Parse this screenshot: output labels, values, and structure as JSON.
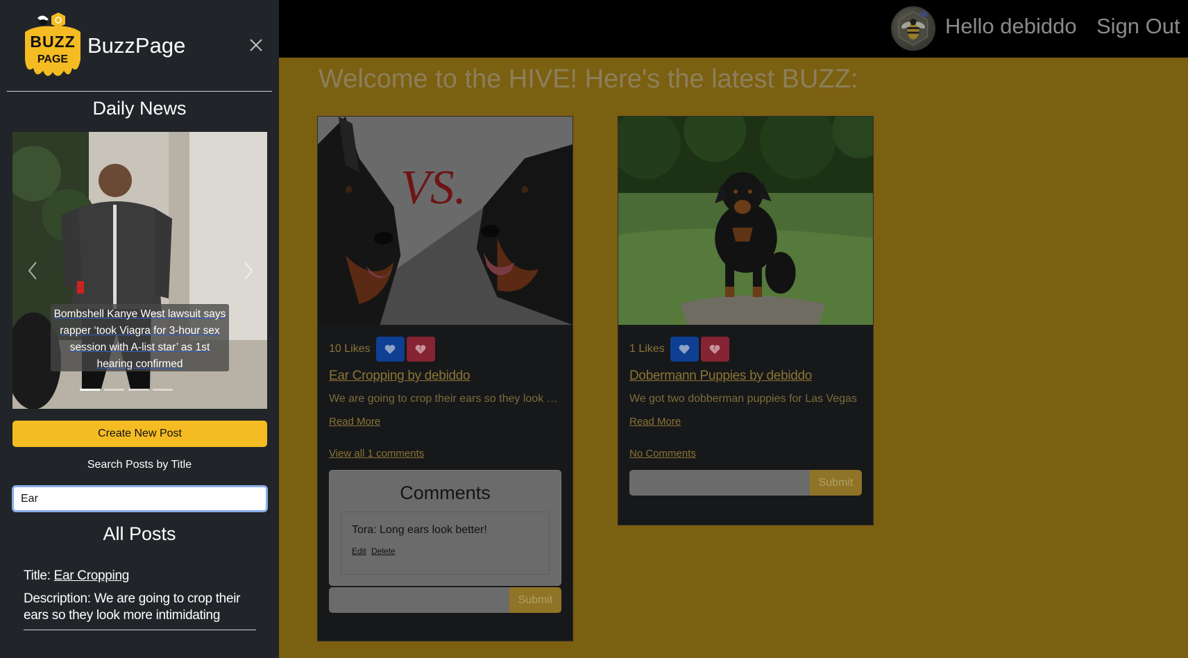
{
  "header": {
    "greeting": "Hello debiddo",
    "sign_out": "Sign Out"
  },
  "welcome": "Welcome to the HIVE! Here's the latest BUZZ:",
  "posts": [
    {
      "likes": "10 Likes",
      "title": "Ear Cropping by debiddo",
      "description": "We are going to crop their ears so they look more intimidating",
      "read_more": "Read More",
      "comments_link": "View all 1 comments",
      "comments_title": "Comments",
      "comments": [
        {
          "text": "Tora: Long ears look better!",
          "edit": "Edit",
          "delete": "Delete"
        }
      ],
      "submit": "Submit",
      "image_text": "VS."
    },
    {
      "likes": "1 Likes",
      "title": "Dobermann Puppies by debiddo",
      "description": "We got two dobberman puppies for Las Vegas",
      "read_more": "Read More",
      "comments_link": "No Comments",
      "submit": "Submit"
    }
  ],
  "sidebar": {
    "brand": "BuzzPage",
    "logo_text": [
      "BUZZ",
      "PAGE"
    ],
    "daily_news": "Daily News",
    "carousel": {
      "caption": "Bombshell Kanye West lawsuit says rapper ‘took Viagra for 3-hour sex session with A-list star’ as 1st hearing confirmed",
      "slide_count": 4,
      "active_index": 0
    },
    "create_post": "Create New Post",
    "search_label": "Search Posts by Title",
    "search_value": "Ear",
    "all_posts": "All Posts",
    "results": [
      {
        "title_label": "Title:",
        "title": "Ear Cropping",
        "description": "Description: We are going to crop their ears so they look more intimidating"
      }
    ]
  },
  "colors": {
    "accent_yellow": "#f4bb22",
    "main_overlay": "#7b6011",
    "sidebar_bg": "#212529",
    "like_blue": "#0e3f92",
    "dislike_red": "#862433"
  }
}
